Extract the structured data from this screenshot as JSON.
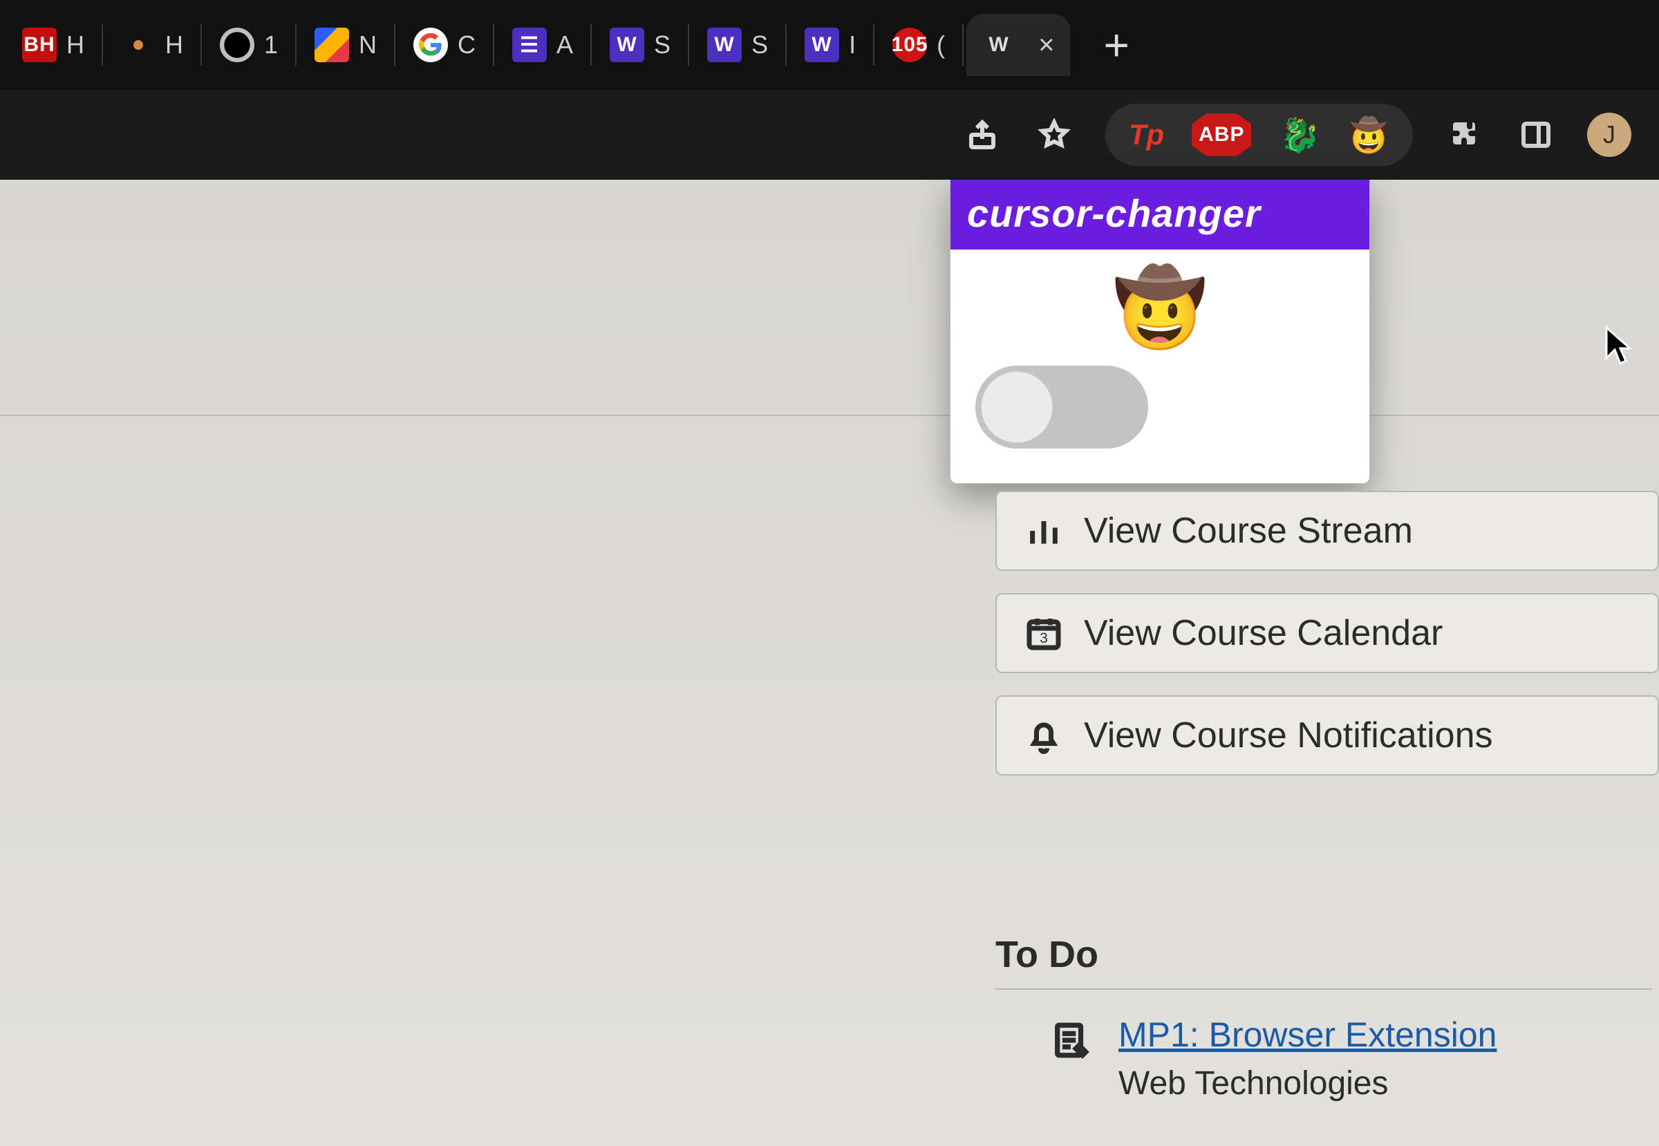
{
  "tabs": [
    {
      "fav": "BH",
      "label": "H"
    },
    {
      "fav": "dot",
      "label": "H"
    },
    {
      "fav": "globe",
      "label": "1"
    },
    {
      "fav": "multi",
      "label": "N"
    },
    {
      "fav": "g",
      "label": "C"
    },
    {
      "fav": "list",
      "label": "A"
    },
    {
      "fav": "w",
      "label": "S"
    },
    {
      "fav": "w",
      "label": "S"
    },
    {
      "fav": "w",
      "label": "I"
    },
    {
      "fav": "red",
      "label": "(",
      "badge": "105"
    },
    {
      "fav": "blank",
      "label": "",
      "active": true
    }
  ],
  "toolbar": {
    "tp_label": "Tp",
    "abp_label": "ABP",
    "avatar_letter": "J"
  },
  "popup": {
    "title": "cursor-changer",
    "emoji": "🤠",
    "toggle_on": false
  },
  "side_buttons": {
    "stream": "View Course Stream",
    "calendar": "View Course Calendar",
    "notifications": "View Course Notifications",
    "calendar_day": "3"
  },
  "todo": {
    "heading": "To Do",
    "item_title": "MP1: Browser Extension",
    "item_sub": "Web Technologies"
  }
}
